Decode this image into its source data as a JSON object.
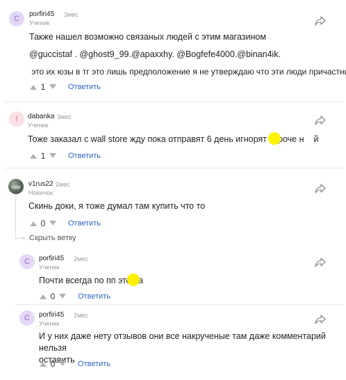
{
  "colors": {
    "link": "#2a62c9",
    "muted": "#9a9a9a",
    "avatar_purple_bg": "#e4d8f7",
    "avatar_pink_bg": "#fbe0e6",
    "redaction": "#fff200"
  },
  "icons": {
    "share": "share-icon",
    "vote_up": "arrow-up-icon",
    "vote_down": "arrow-down-icon",
    "collapse": "minus-icon"
  },
  "comments": [
    {
      "avatar_letter": "C",
      "author": "porfiri45",
      "time": "3мес",
      "role": "Ученик",
      "text": [
        "Также нашел возможно связаных людей с этим магазином",
        "@guccistaf . @ghost9_99.@apaxxhy. @Bogfefe4000.@binan4ik.",
        " это их юзы в тг это лишь предположение я не утверждаю что эти люди причастны"
      ],
      "score": "1",
      "reply_label": "Ответить"
    },
    {
      "avatar_letter": "I",
      "author": "dabanka",
      "time": "3мес",
      "role": "Ученик",
      "text": [
        "Тоже заказал с wall store жду пока отправят 6 день игнорят короче н"
      ],
      "text_tail": "й",
      "score": "1",
      "reply_label": "Ответить"
    },
    {
      "author": "v1rus22",
      "time": "2мес",
      "role": "Новичок",
      "text": [
        "Скинь доки, я тоже думал там купить что то"
      ],
      "score": "0",
      "reply_label": "Ответить",
      "collapse_label": "Скрыть ветку"
    },
    {
      "avatar_letter": "C",
      "author": "porfiri45",
      "time": "2мес",
      "role": "Ученик",
      "text": [
        "Почти всегда по пп это на"
      ],
      "score": "0",
      "reply_label": "Ответить"
    },
    {
      "avatar_letter": "C",
      "author": "porfiri45",
      "time": "2мес",
      "role": "Ученик",
      "text": [
        "И у них даже нету отзывов они все накрученые там даже комментарий нельзя",
        "оставить"
      ],
      "score": "0",
      "reply_label": "Ответить"
    }
  ]
}
